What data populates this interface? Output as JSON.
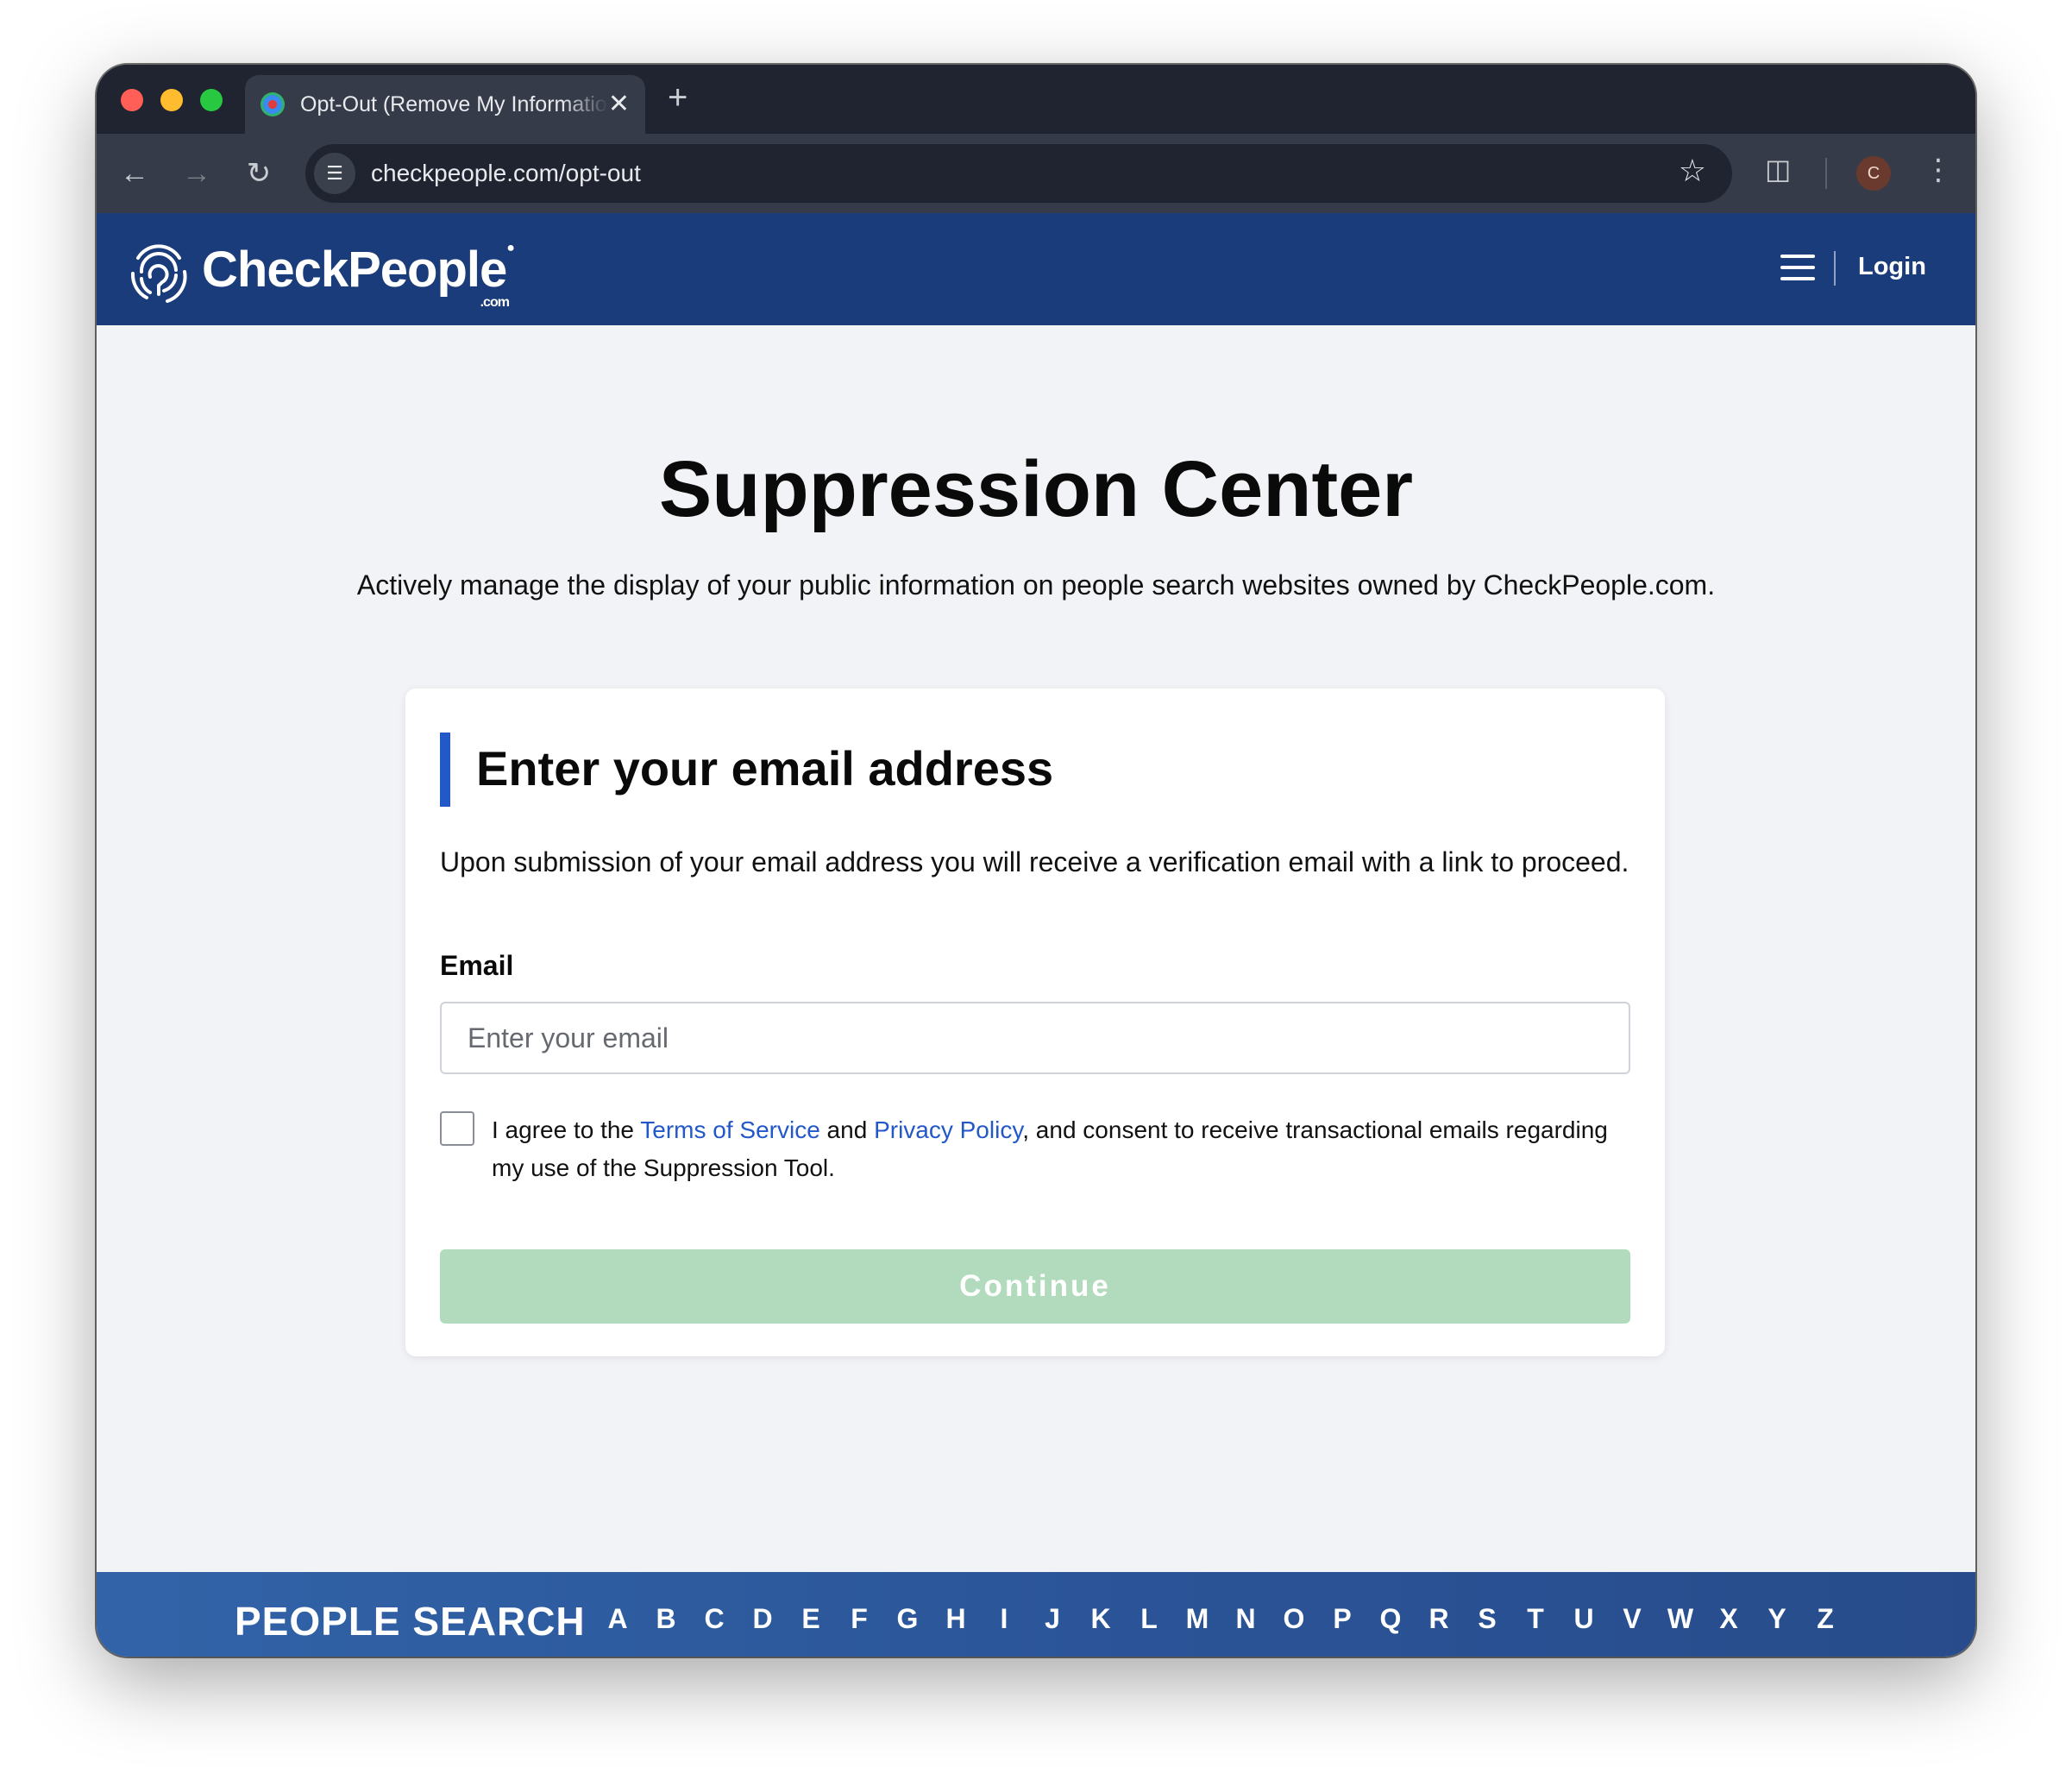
{
  "browser": {
    "tab_title": "Opt-Out (Remove My Information)",
    "tab_close_glyph": "✕",
    "new_tab_glyph": "+",
    "url": "checkpeople.com/opt-out",
    "profile_initial": "C"
  },
  "header": {
    "logo_text": "CheckPeople",
    "logo_suffix": ".com",
    "login_label": "Login"
  },
  "main": {
    "title": "Suppression Center",
    "subtitle": "Actively manage the display of your public information on people search websites owned by CheckPeople.com."
  },
  "form": {
    "heading": "Enter your email address",
    "description": "Upon submission of your email address you will receive a verification email with a link to proceed.",
    "email_label": "Email",
    "email_placeholder": "Enter your email",
    "email_value": "",
    "agree_prefix": "I agree to the ",
    "terms_link": "Terms of Service",
    "agree_and": " and ",
    "privacy_link": "Privacy Policy",
    "agree_suffix": ", and consent to receive transactional emails regarding my use of the Suppression Tool.",
    "agree_checked": false,
    "continue_label": "Continue",
    "continue_enabled": false
  },
  "footer": {
    "people_search_label": "PEOPLE SEARCH",
    "letters": [
      "A",
      "B",
      "C",
      "D",
      "E",
      "F",
      "G",
      "H",
      "I",
      "J",
      "K",
      "L",
      "M",
      "N",
      "O",
      "P",
      "Q",
      "R",
      "S",
      "T",
      "U",
      "V",
      "W",
      "X",
      "Y",
      "Z"
    ]
  },
  "colors": {
    "header_bg": "#1b3c7a",
    "accent_blue": "#2358c8",
    "continue_disabled": "#b2dbbd",
    "page_bg": "#f2f3f6"
  }
}
